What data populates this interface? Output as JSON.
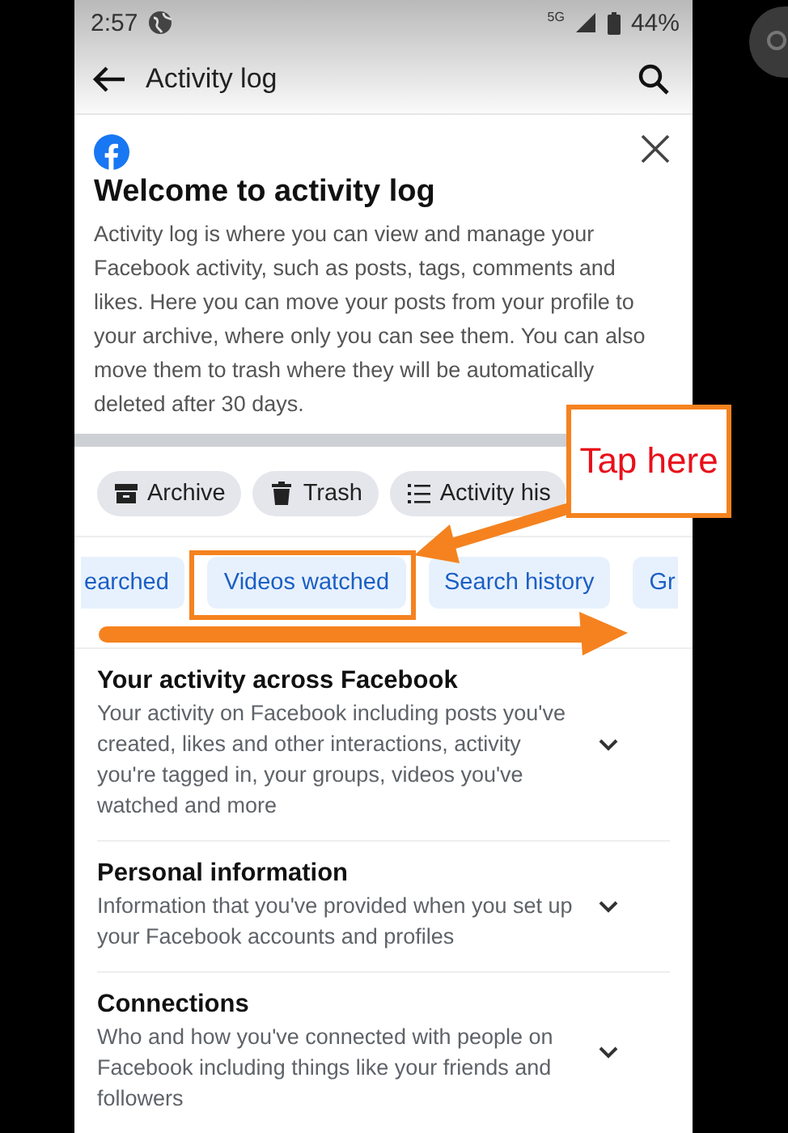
{
  "status_bar": {
    "time": "2:57",
    "network": "5G",
    "battery": "44%"
  },
  "app_bar": {
    "title": "Activity log"
  },
  "welcome_card": {
    "title": "Welcome to activity log",
    "body": "Activity log is where you can view and manage your Facebook activity, such as posts, tags, comments and likes. Here you can move your posts from your profile to your archive, where only you can see them. You can also move them to trash where they will be automatically deleted after 30 days."
  },
  "chips": [
    {
      "kind": "archive",
      "label": "Archive"
    },
    {
      "kind": "trash",
      "label": "Trash"
    },
    {
      "kind": "list",
      "label": "Activity his"
    }
  ],
  "tabs": [
    {
      "label": "earched"
    },
    {
      "label": "Videos watched"
    },
    {
      "label": "Search history"
    },
    {
      "label": "Gr"
    }
  ],
  "sections": [
    {
      "title": "Your activity across Facebook",
      "description": "Your activity on Facebook including posts you've created, likes and other interactions, activity you're tagged in, your groups, videos you've watched and more"
    },
    {
      "title": "Personal information",
      "description": "Information that you've provided when you set up your Facebook accounts and profiles"
    },
    {
      "title": "Connections",
      "description": "Who and how you've connected with people on Facebook including things like your friends and followers"
    }
  ],
  "annotation": {
    "callout": "Tap here"
  }
}
